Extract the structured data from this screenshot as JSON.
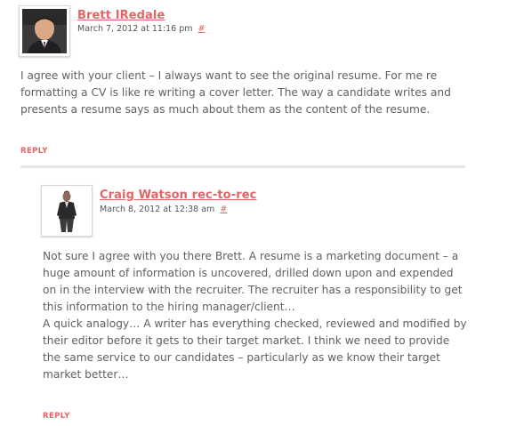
{
  "accent_color": "#e06666",
  "comments": [
    {
      "author": "Brett IRedale",
      "date": "March 7, 2012 at 11:16 pm",
      "permalink": "#",
      "avatar_icon": "avatar-photo-man-suit",
      "paragraphs": [
        "I agree with your client – I always want to see the original resume. For me re formatting a CV is like re writing a cover letter. The way a candidate writes and presents a resume says as much about them as the content of the resume."
      ],
      "reply_label": "REPLY"
    },
    {
      "author": "Craig Watson rec-to-rec",
      "date": "March 8, 2012 at 12:38 am",
      "permalink": "#",
      "avatar_icon": "avatar-photo-man-standing",
      "paragraphs": [
        "Not sure I agree with you there Brett. A resume is a marketing document – a huge amount of information is uncovered, drilled down upon and expended on in the interview with the recruiter. The recruiter has a responsibility to get this information to the hiring manager/client…",
        "A quick analogy… A writer has everything checked, reviewed and modified by their editor before it gets to their target market. I think we need to provide the same service to our candidates – particularly as we know their target market better…"
      ],
      "reply_label": "REPLY"
    }
  ]
}
